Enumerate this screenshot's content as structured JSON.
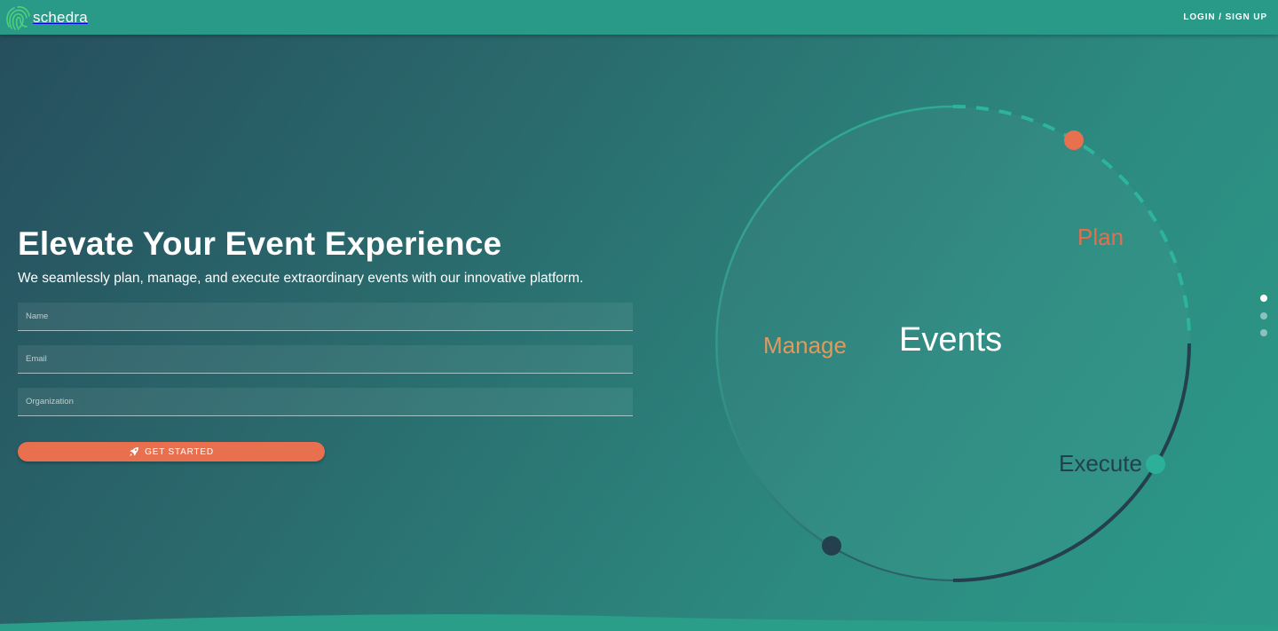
{
  "header": {
    "brand": "schedra",
    "login_label": "LOGIN / SIGN UP"
  },
  "hero": {
    "title": "Elevate Your Event Experience",
    "subtitle": "We seamlessly plan, manage, and execute extraordinary events with our innovative platform."
  },
  "form": {
    "name_placeholder": "Name",
    "email_placeholder": "Email",
    "organization_placeholder": "Organization",
    "submit_label": "GET STARTED",
    "submit_icon": "rocket-icon"
  },
  "diagram": {
    "center_label": "Events",
    "stages": [
      {
        "label": "Plan",
        "color": "#e36f4f"
      },
      {
        "label": "Manage",
        "color": "#e09a5c"
      },
      {
        "label": "Execute",
        "color": "#24404e"
      }
    ]
  },
  "slider": {
    "slide_count": 3,
    "active_index": 0
  },
  "colors": {
    "header": "#2a9a88",
    "accent": "#e9704f",
    "dark": "#24404e"
  }
}
